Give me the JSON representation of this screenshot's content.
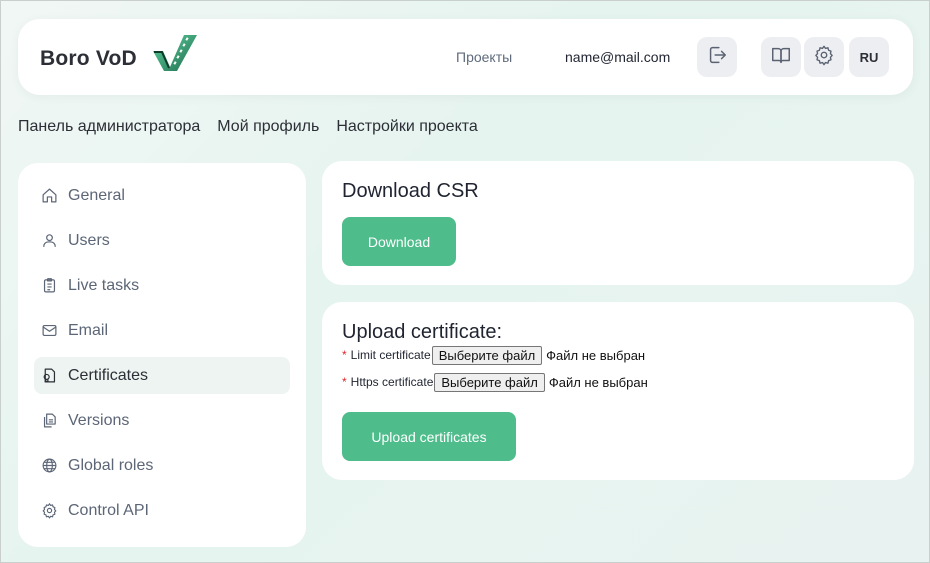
{
  "header": {
    "logo_text": "Boro VoD",
    "nav_projects": "Проекты",
    "user_email": "name@mail.com",
    "lang": "RU"
  },
  "tabs": [
    {
      "label": "Панель администратора"
    },
    {
      "label": "Мой профиль"
    },
    {
      "label": "Настройки проекта"
    }
  ],
  "sidebar": {
    "items": [
      {
        "label": "General",
        "icon": "home-icon"
      },
      {
        "label": "Users",
        "icon": "user-icon"
      },
      {
        "label": "Live tasks",
        "icon": "clipboard-icon"
      },
      {
        "label": "Email",
        "icon": "mail-icon"
      },
      {
        "label": "Certificates",
        "icon": "certificate-icon",
        "active": true
      },
      {
        "label": "Versions",
        "icon": "files-icon"
      },
      {
        "label": "Global roles",
        "icon": "globe-icon"
      },
      {
        "label": "Control API",
        "icon": "gear-icon"
      }
    ]
  },
  "csr_card": {
    "title": "Download CSR",
    "button": "Download"
  },
  "upload_card": {
    "title": "Upload certificate:",
    "required_mark": "*",
    "rows": [
      {
        "label": "Limit certificate",
        "button": "Выберите файл",
        "status": "Файл не выбран"
      },
      {
        "label": "Https certificate",
        "button": "Выберите файл",
        "status": "Файл не выбран"
      }
    ],
    "submit": "Upload certificates"
  },
  "colors": {
    "accent_green": "#4ebc8b",
    "required_red": "#e0252b",
    "active_bg": "#edf4f1"
  }
}
